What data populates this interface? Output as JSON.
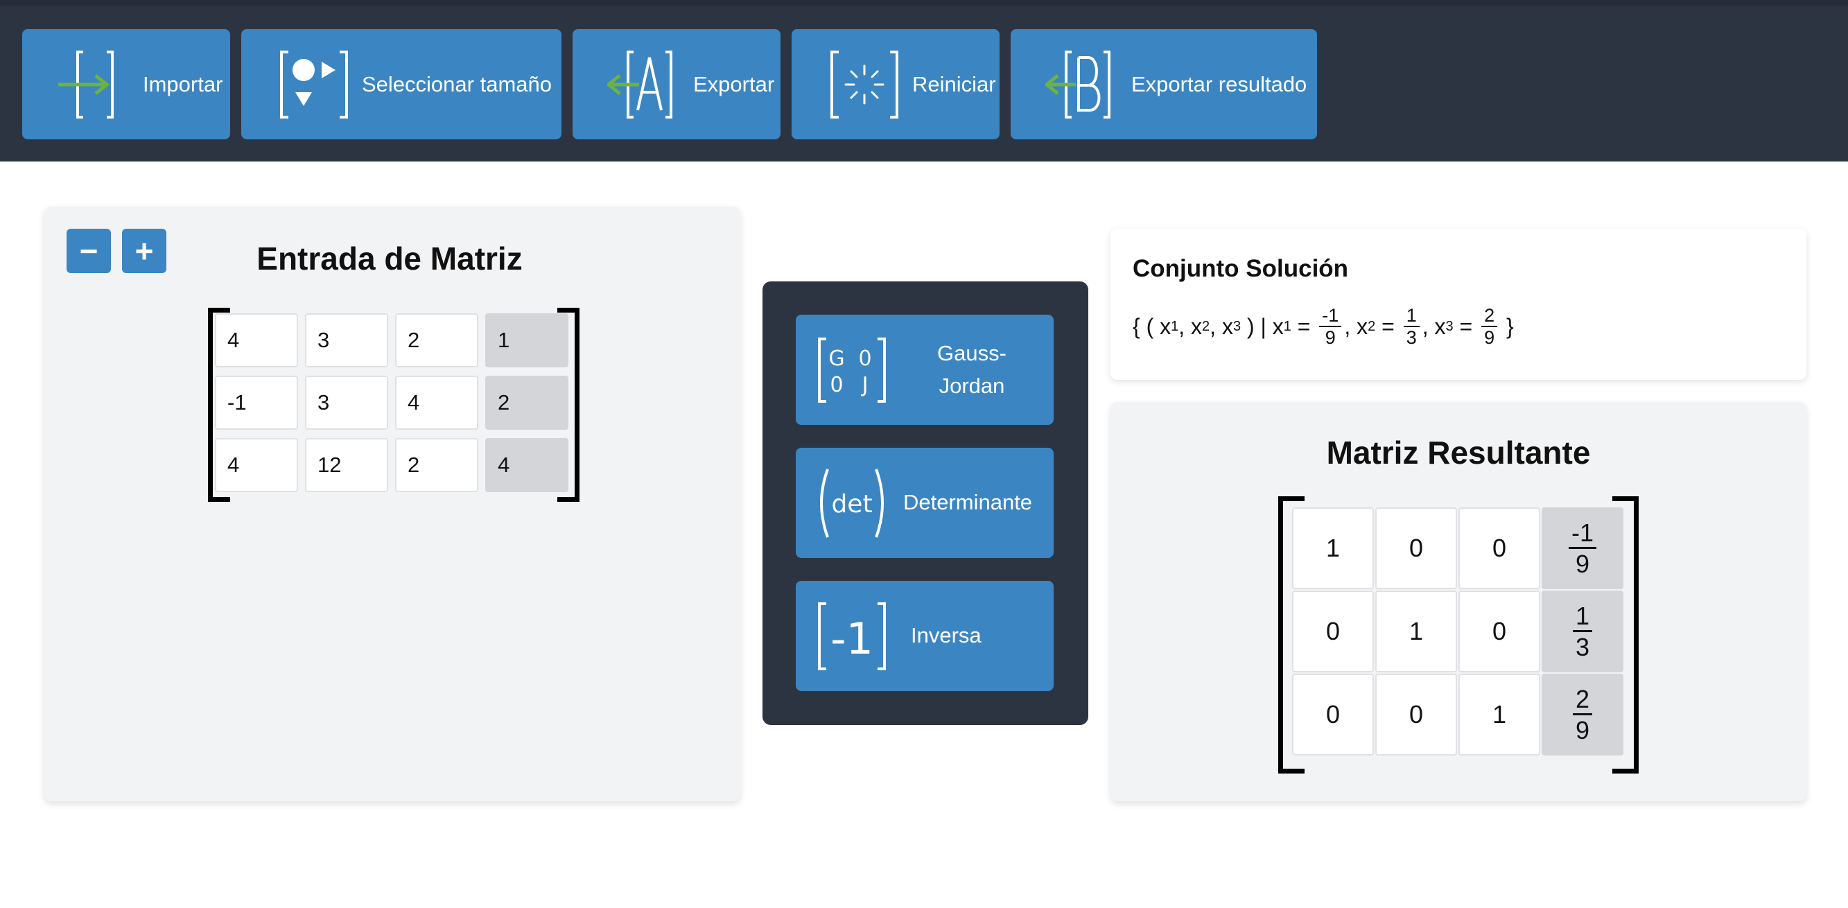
{
  "toolbar": {
    "buttons": [
      {
        "label": "Importar",
        "icon": "import-icon"
      },
      {
        "label": "Seleccionar tamaño",
        "icon": "select-size-icon"
      },
      {
        "label": "Exportar",
        "icon": "export-a-icon"
      },
      {
        "label": "Reiniciar",
        "icon": "reset-icon"
      },
      {
        "label": "Exportar resultado",
        "icon": "export-b-icon"
      }
    ]
  },
  "input_panel": {
    "title": "Entrada de Matriz",
    "minus_label": "−",
    "plus_label": "+",
    "rows": [
      [
        "4",
        "3",
        "2",
        "1"
      ],
      [
        "-1",
        "3",
        "4",
        "2"
      ],
      [
        "4",
        "12",
        "2",
        "4"
      ]
    ]
  },
  "operations": {
    "gauss": {
      "label": "Gauss-Jordan",
      "icon_text_1": "G",
      "icon_text_2": "0",
      "icon_text_3": "0",
      "icon_text_4": "J"
    },
    "det": {
      "label": "Determinante",
      "icon_text": "det"
    },
    "inv": {
      "label": "Inversa",
      "icon_text": "-1"
    }
  },
  "solution": {
    "title": "Conjunto Solución",
    "open": "{ ( x",
    "sub1": "1",
    "sep1": ", x",
    "sub2": "2",
    "sep2": ", x",
    "sub3": "3",
    "mid": " ) | x",
    "s1": "1",
    "eq1": " = ",
    "x1_num": "-1",
    "x1_den": "9",
    "c1": ", x",
    "s2": "2",
    "eq2": " = ",
    "x2_num": "1",
    "x2_den": "3",
    "c2": ", x",
    "s3": "3",
    "eq3": " = ",
    "x3_num": "2",
    "x3_den": "9",
    "close": " }"
  },
  "result_panel": {
    "title": "Matriz Resultante",
    "rows": [
      [
        "1",
        "0",
        "0"
      ],
      [
        "0",
        "1",
        "0"
      ],
      [
        "0",
        "0",
        "1"
      ]
    ],
    "aug": [
      {
        "num": "-1",
        "den": "9"
      },
      {
        "num": "1",
        "den": "3"
      },
      {
        "num": "2",
        "den": "9"
      }
    ]
  },
  "colors": {
    "toolbar_bg": "#2d3441",
    "button_blue": "#3b86c2",
    "icon_green": "#6db33f",
    "panel_bg": "#f2f3f5",
    "aug_cell": "#d3d5d9"
  }
}
